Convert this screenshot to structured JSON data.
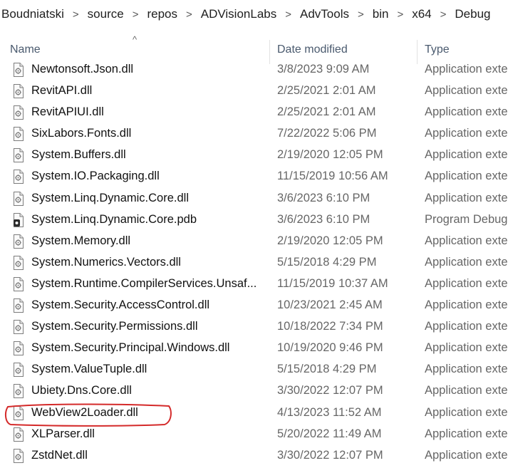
{
  "breadcrumb": [
    "Boudniatski",
    "source",
    "repos",
    "ADVisionLabs",
    "AdvTools",
    "bin",
    "x64",
    "Debug"
  ],
  "breadcrumb_separator": ">",
  "columns": {
    "name": "Name",
    "date": "Date modified",
    "type": "Type"
  },
  "sort_indicator": "^",
  "files": [
    {
      "name": "Newtonsoft.Json.dll",
      "date": "3/8/2023 9:09 AM",
      "type": "Application exte",
      "icon": "dll-file-icon"
    },
    {
      "name": "RevitAPI.dll",
      "date": "2/25/2021 2:01 AM",
      "type": "Application exte",
      "icon": "dll-file-icon"
    },
    {
      "name": "RevitAPIUI.dll",
      "date": "2/25/2021 2:01 AM",
      "type": "Application exte",
      "icon": "dll-file-icon"
    },
    {
      "name": "SixLabors.Fonts.dll",
      "date": "7/22/2022 5:06 PM",
      "type": "Application exte",
      "icon": "dll-file-icon"
    },
    {
      "name": "System.Buffers.dll",
      "date": "2/19/2020 12:05 PM",
      "type": "Application exte",
      "icon": "dll-file-icon"
    },
    {
      "name": "System.IO.Packaging.dll",
      "date": "11/15/2019 10:56 AM",
      "type": "Application exte",
      "icon": "dll-file-icon"
    },
    {
      "name": "System.Linq.Dynamic.Core.dll",
      "date": "3/6/2023 6:10 PM",
      "type": "Application exte",
      "icon": "dll-file-icon"
    },
    {
      "name": "System.Linq.Dynamic.Core.pdb",
      "date": "3/6/2023 6:10 PM",
      "type": "Program Debug",
      "icon": "pdb-file-icon"
    },
    {
      "name": "System.Memory.dll",
      "date": "2/19/2020 12:05 PM",
      "type": "Application exte",
      "icon": "dll-file-icon"
    },
    {
      "name": "System.Numerics.Vectors.dll",
      "date": "5/15/2018 4:29 PM",
      "type": "Application exte",
      "icon": "dll-file-icon"
    },
    {
      "name": "System.Runtime.CompilerServices.Unsaf...",
      "date": "11/15/2019 10:37 AM",
      "type": "Application exte",
      "icon": "dll-file-icon"
    },
    {
      "name": "System.Security.AccessControl.dll",
      "date": "10/23/2021 2:45 AM",
      "type": "Application exte",
      "icon": "dll-file-icon"
    },
    {
      "name": "System.Security.Permissions.dll",
      "date": "10/18/2022 7:34 PM",
      "type": "Application exte",
      "icon": "dll-file-icon"
    },
    {
      "name": "System.Security.Principal.Windows.dll",
      "date": "10/19/2020 9:46 PM",
      "type": "Application exte",
      "icon": "dll-file-icon"
    },
    {
      "name": "System.ValueTuple.dll",
      "date": "5/15/2018 4:29 PM",
      "type": "Application exte",
      "icon": "dll-file-icon"
    },
    {
      "name": "Ubiety.Dns.Core.dll",
      "date": "3/30/2022 12:07 PM",
      "type": "Application exte",
      "icon": "dll-file-icon"
    },
    {
      "name": "WebView2Loader.dll",
      "date": "4/13/2023 11:52 AM",
      "type": "Application exte",
      "icon": "dll-file-icon",
      "highlighted": true
    },
    {
      "name": "XLParser.dll",
      "date": "5/20/2022 11:49 AM",
      "type": "Application exte",
      "icon": "dll-file-icon"
    },
    {
      "name": "ZstdNet.dll",
      "date": "3/30/2022 12:07 PM",
      "type": "Application exte",
      "icon": "dll-file-icon"
    }
  ],
  "colors": {
    "highlight_ring": "#d42a2a",
    "header_text": "#4a5a6e",
    "secondary_text": "#666666"
  }
}
